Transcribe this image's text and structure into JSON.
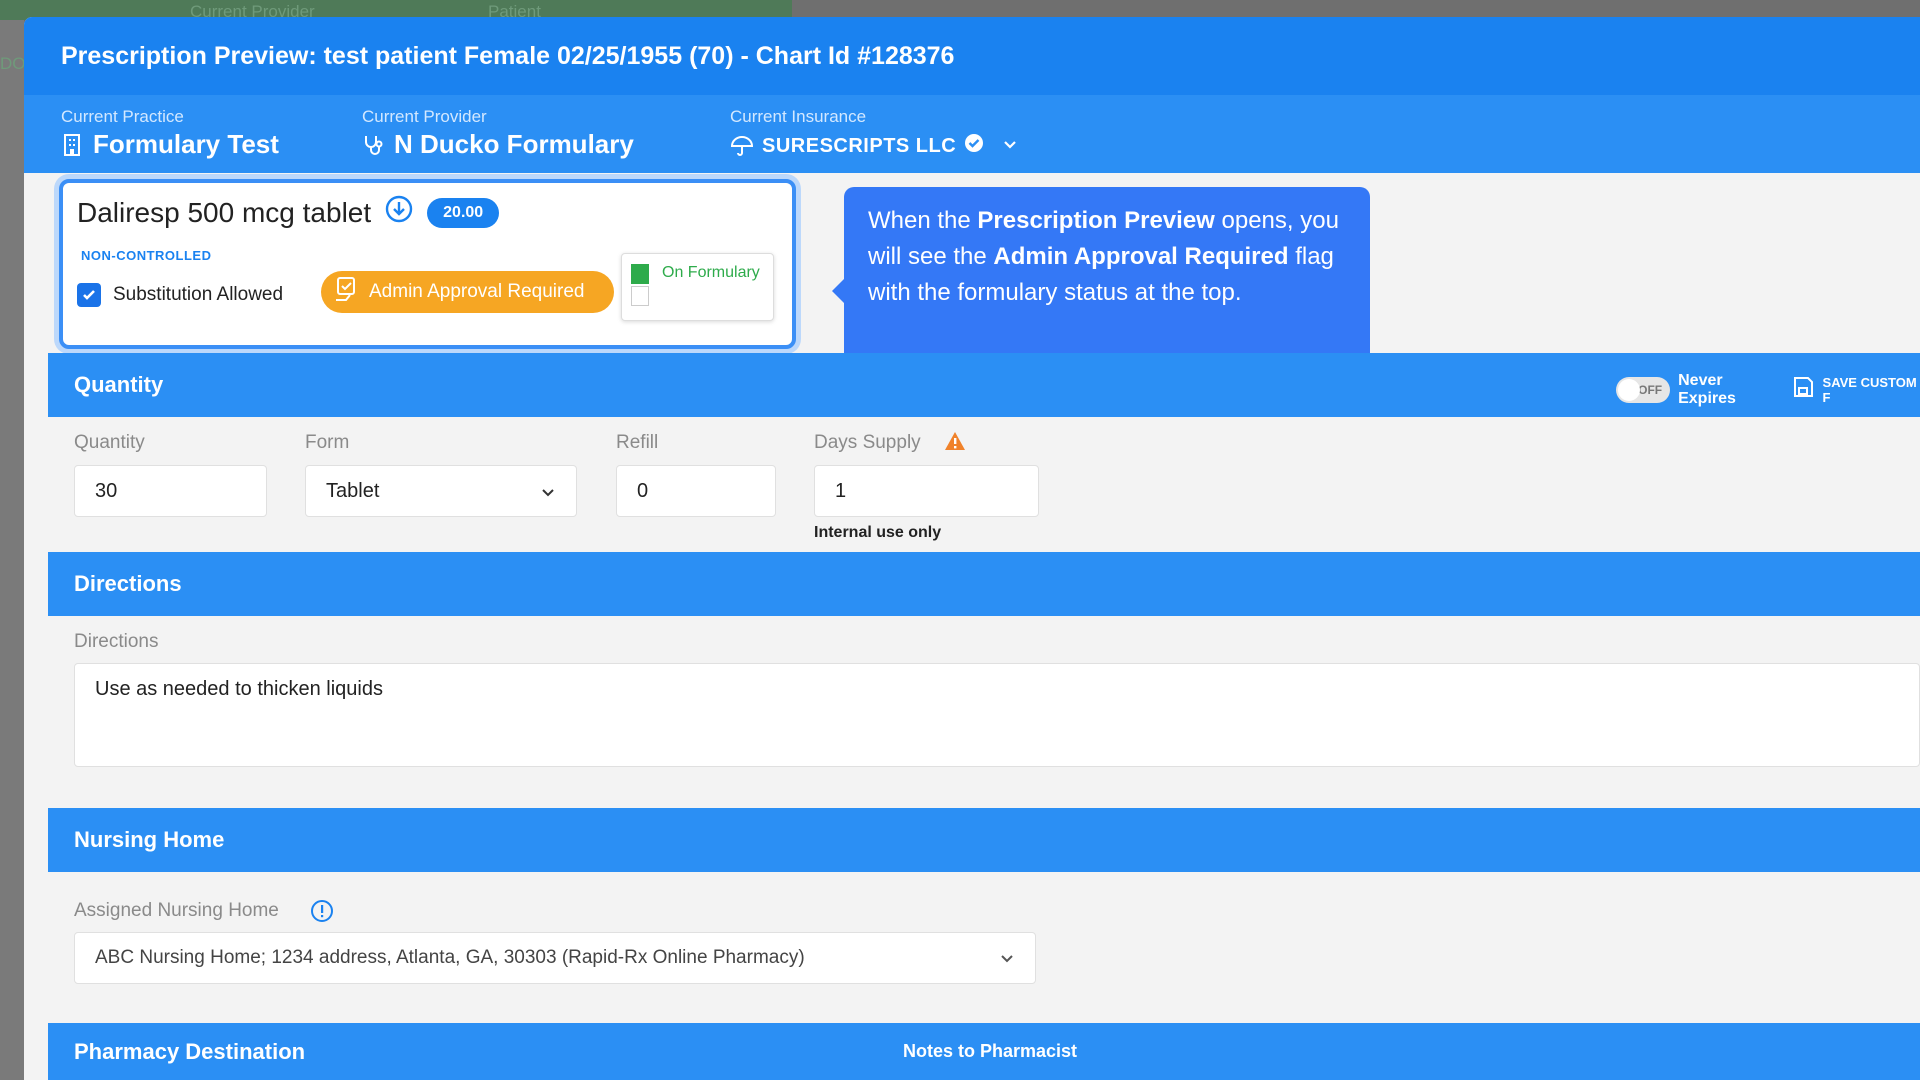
{
  "background": {
    "labels": [
      "Current Provider",
      "Patient"
    ],
    "side_text": "DO"
  },
  "modal": {
    "title": "Prescription Preview: test patient Female 02/25/1955 (70) - Chart Id #128376"
  },
  "context": {
    "practice_label": "Current Practice",
    "practice_value": "Formulary Test",
    "provider_label": "Current Provider",
    "provider_value": "N Ducko Formulary",
    "insurance_label": "Current Insurance",
    "insurance_value": "SURESCRIPTS LLC"
  },
  "medication": {
    "name": "Daliresp 500 mcg tablet",
    "price": "20.00",
    "schedule": "NON-CONTROLLED",
    "substitution_label": "Substitution Allowed",
    "substitution_checked": true,
    "admin_flag": "Admin Approval Required",
    "formulary_status": "On Formulary"
  },
  "tooltip": {
    "part1": "When the ",
    "bold1": "Prescription Preview",
    "part2": " opens, you will see the ",
    "bold2": "Admin Approval Required",
    "part3": " flag with the formulary status at the top."
  },
  "quantity_section": {
    "title": "Quantity",
    "toggle_state": "OFF",
    "never_expires": "Never Expires",
    "save_custom": "SAVE CUSTOM F",
    "quantity_label": "Quantity",
    "quantity_value": "30",
    "form_label": "Form",
    "form_value": "Tablet",
    "refill_label": "Refill",
    "refill_value": "0",
    "days_supply_label": "Days Supply",
    "days_supply_value": "1",
    "internal_note": "Internal use only"
  },
  "directions_section": {
    "title": "Directions",
    "field_label": "Directions",
    "value": "Use as needed to thicken liquids"
  },
  "nursing_section": {
    "title": "Nursing Home",
    "field_label": "Assigned Nursing Home",
    "value": "ABC Nursing Home; 1234 address, Atlanta, GA, 30303 (Rapid-Rx Online Pharmacy)"
  },
  "pharmacy_section": {
    "title": "Pharmacy Destination",
    "notes_label": "Notes to Pharmacist"
  },
  "colors": {
    "primary": "#1a82f0",
    "header_bar": "#2b8ff4",
    "warning": "#f6a623",
    "success": "#2eab4b"
  }
}
